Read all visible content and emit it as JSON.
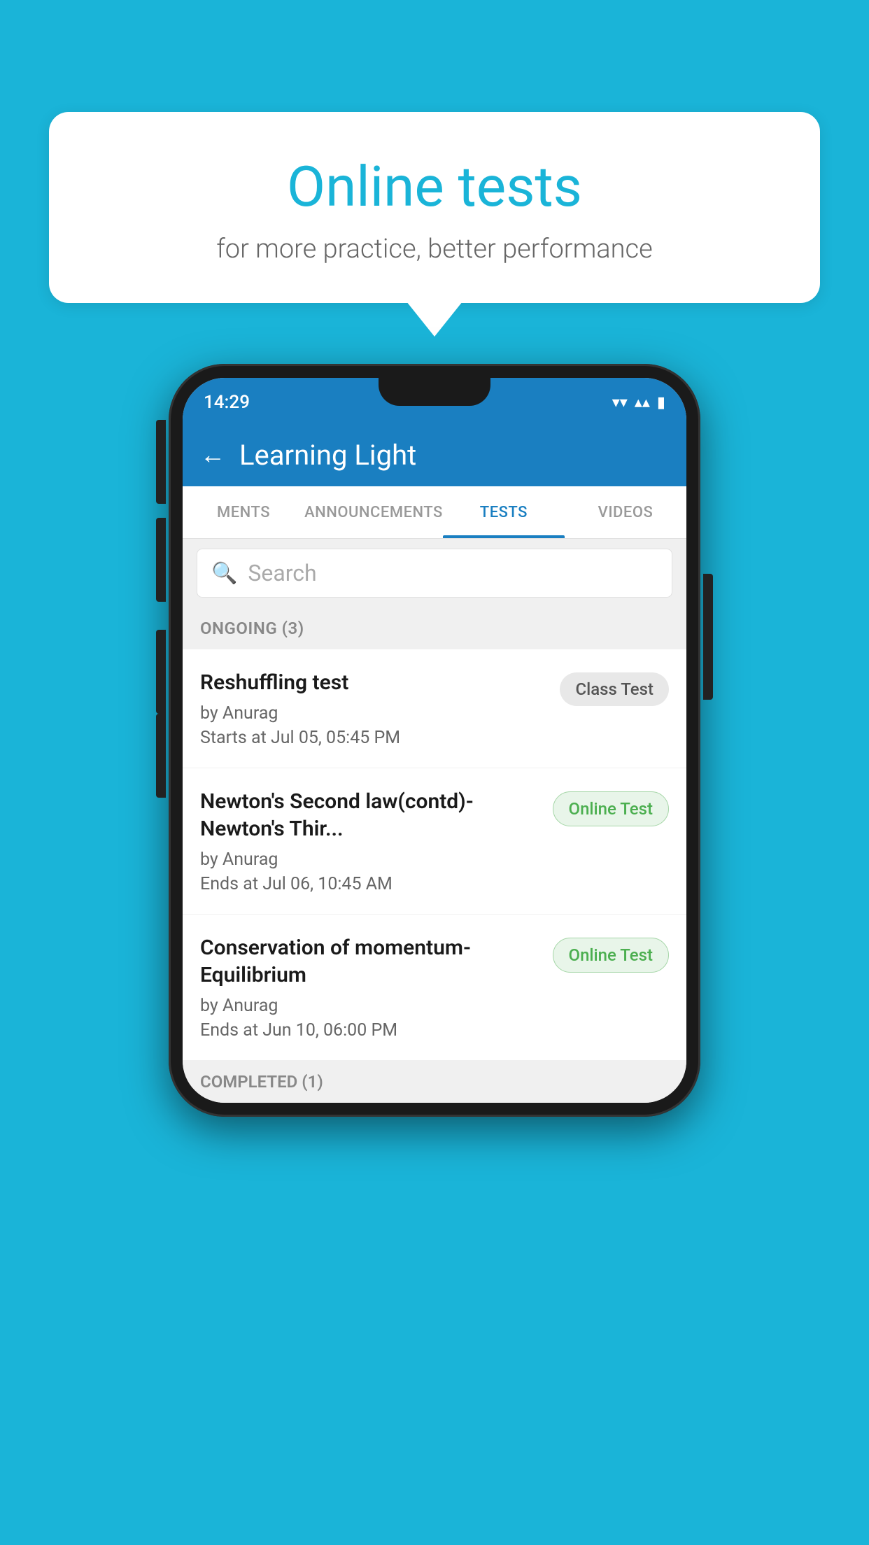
{
  "background": {
    "color": "#1ab4d8"
  },
  "bubble": {
    "title": "Online tests",
    "subtitle": "for more practice, better performance"
  },
  "phone": {
    "status_bar": {
      "time": "14:29",
      "wifi_icon": "▾",
      "signal_icon": "▴▴",
      "battery_icon": "▮"
    },
    "header": {
      "back_label": "←",
      "title": "Learning Light"
    },
    "tabs": [
      {
        "label": "MENTS",
        "active": false
      },
      {
        "label": "ANNOUNCEMENTS",
        "active": false
      },
      {
        "label": "TESTS",
        "active": true
      },
      {
        "label": "VIDEOS",
        "active": false
      }
    ],
    "search": {
      "placeholder": "Search"
    },
    "ongoing_section": {
      "label": "ONGOING (3)"
    },
    "tests": [
      {
        "name": "Reshuffling test",
        "author": "by Anurag",
        "date_label": "Starts at",
        "date": "Jul 05, 05:45 PM",
        "badge": "Class Test",
        "badge_type": "class"
      },
      {
        "name": "Newton's Second law(contd)-Newton's Thir...",
        "author": "by Anurag",
        "date_label": "Ends at",
        "date": "Jul 06, 10:45 AM",
        "badge": "Online Test",
        "badge_type": "online"
      },
      {
        "name": "Conservation of momentum-Equilibrium",
        "author": "by Anurag",
        "date_label": "Ends at",
        "date": "Jun 10, 06:00 PM",
        "badge": "Online Test",
        "badge_type": "online"
      }
    ],
    "completed_section": {
      "label": "COMPLETED (1)"
    }
  }
}
